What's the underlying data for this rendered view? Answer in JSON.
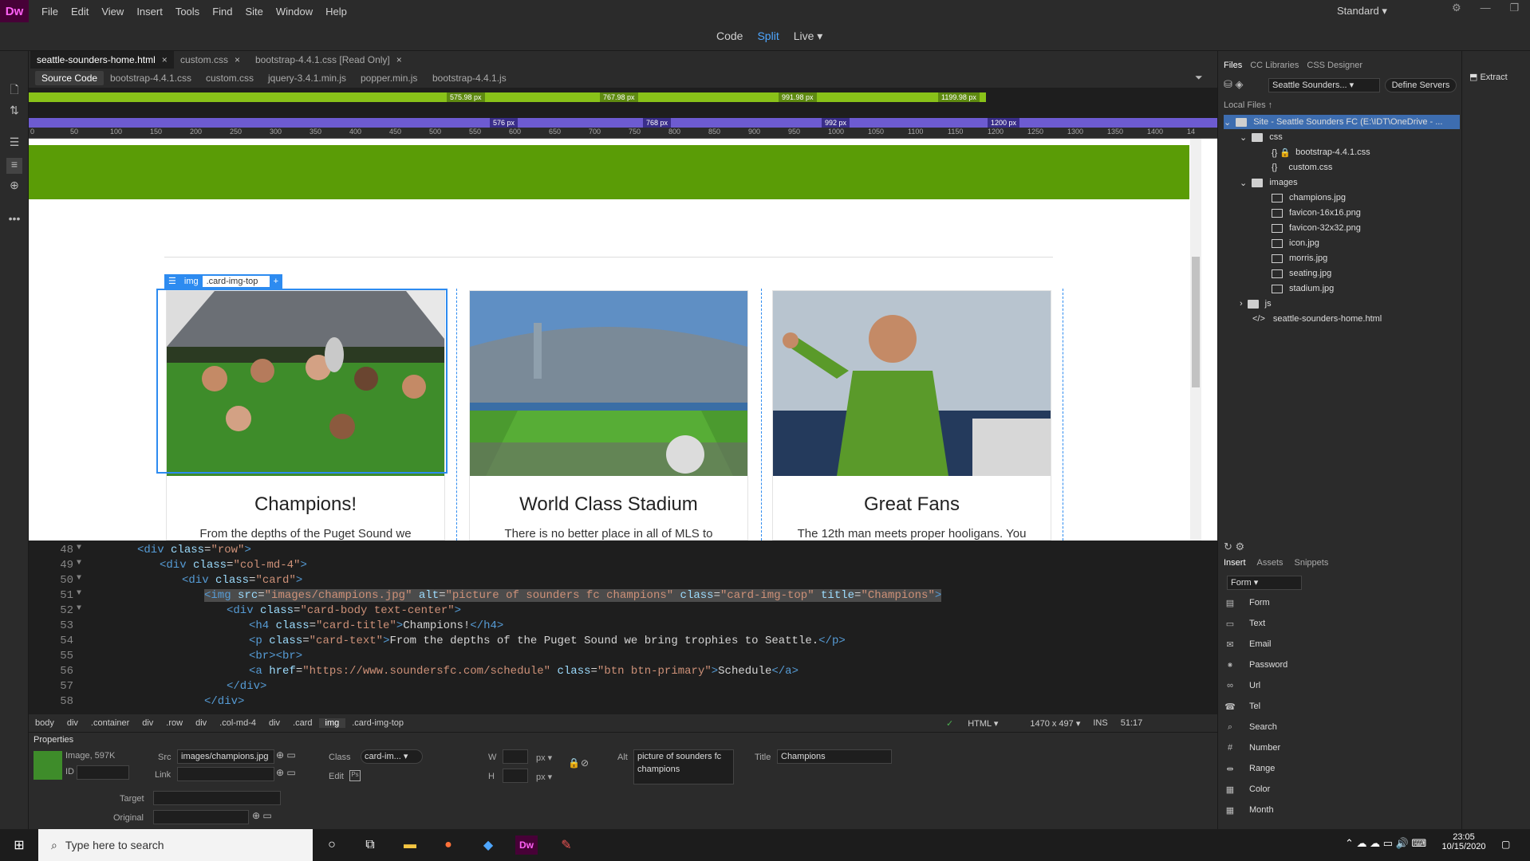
{
  "app": {
    "logo": "Dw",
    "menu": [
      "File",
      "Edit",
      "View",
      "Insert",
      "Tools",
      "Find",
      "Site",
      "Window",
      "Help"
    ],
    "workspace": "Standard"
  },
  "view": {
    "code": "Code",
    "split": "Split",
    "live": "Live"
  },
  "tabs": [
    {
      "label": "seattle-sounders-home.html"
    },
    {
      "label": "custom.css"
    },
    {
      "label": "bootstrap-4.4.1.css [Read Only]"
    }
  ],
  "source": [
    "Source Code",
    "bootstrap-4.4.1.css",
    "custom.css",
    "jquery-3.4.1.min.js",
    "popper.min.js",
    "bootstrap-4.4.1.js"
  ],
  "mq_max": [
    "575.98",
    "767.98",
    "991.98",
    "1199.98"
  ],
  "mq_min": [
    "576",
    "768",
    "992",
    "1200"
  ],
  "ruler": [
    "0",
    "50",
    "100",
    "150",
    "200",
    "250",
    "300",
    "350",
    "400",
    "450",
    "500",
    "550",
    "600",
    "650",
    "700",
    "750",
    "800",
    "850",
    "900",
    "950",
    "1000",
    "1050",
    "1100",
    "1150",
    "1200",
    "1250",
    "1300",
    "1350",
    "1400",
    "14"
  ],
  "eltag": {
    "tag": "img",
    "cls": ".card-img-top"
  },
  "cards": [
    {
      "title": "Champions!",
      "text": "From the depths of the Puget Sound we"
    },
    {
      "title": "World Class Stadium",
      "text": "There is no better place in all of MLS to"
    },
    {
      "title": "Great Fans",
      "text": "The 12th man meets proper hooligans. You"
    }
  ],
  "code": {
    "lines": [
      "48",
      "49",
      "50",
      "51",
      "52",
      "53",
      "54",
      "55",
      "56",
      "57",
      "58"
    ],
    "l48a": "<div ",
    "l48b": "class",
    "l48c": "=",
    "l48d": "\"row\"",
    "l48e": ">",
    "l49a": "<div ",
    "l49b": "class",
    "l49d": "\"col-md-4\"",
    "l49e": ">",
    "l50a": "<div ",
    "l50b": "class",
    "l50d": "\"card\"",
    "l50e": ">",
    "l51a": "<img ",
    "l51b": "src",
    "l51c": "=",
    "l51d": "\"images/champions.jpg\"",
    "l51f": " alt",
    "l51g": "\"picture of sounders fc champions\"",
    "l51h": " class",
    "l51i": "\"card-img-top\"",
    "l51j": " title",
    "l51k": "\"Champions\"",
    "l51e": ">",
    "l52a": "<div ",
    "l52b": "class",
    "l52d": "\"card-body text-center\"",
    "l52e": ">",
    "l53a": "<h4 ",
    "l53b": "class",
    "l53d": "\"card-title\"",
    "l53e": ">",
    "l53t": "Champions!",
    "l53z": "</h4>",
    "l54a": "<p ",
    "l54b": "class",
    "l54d": "\"card-text\"",
    "l54e": ">",
    "l54t": "From the depths of the Puget Sound we bring trophies to Seattle.",
    "l54z": "</p>",
    "l55": "<br><br>",
    "l56a": "<a ",
    "l56b": "href",
    "l56d": "\"https://www.soundersfc.com/schedule\"",
    "l56f": " class",
    "l56g": "\"btn btn-primary\"",
    "l56e": ">",
    "l56t": "Schedule",
    "l56z": "</a>",
    "l57": "</div>",
    "l58": "</div>"
  },
  "tagbar": [
    "body",
    "div",
    ".container",
    "div",
    ".row",
    "div",
    ".col-md-4",
    "div",
    ".card",
    "img",
    ".card-img-top"
  ],
  "status": {
    "lang": "HTML",
    "size": "1470 x 497",
    "mode": "INS",
    "pos": "51:17"
  },
  "props": {
    "header": "Properties",
    "type": "Image, 597K",
    "id_label": "ID",
    "src_label": "Src",
    "src": "images/champions.jpg",
    "link_label": "Link",
    "class_label": "Class",
    "class_val": "card-im...",
    "edit_label": "Edit",
    "w": "W",
    "h": "H",
    "px": "px",
    "alt_label": "Alt",
    "alt": "picture of sounders fc champions",
    "title_label": "Title",
    "title": "Champions",
    "target": "Target",
    "original": "Original"
  },
  "files": {
    "tabs": [
      "Files",
      "CC Libraries",
      "CSS Designer"
    ],
    "site": "Seattle Sounders...",
    "define": "Define Servers",
    "local": "Local Files",
    "tree": [
      "Site - Seattle Sounders FC (E:\\IDT\\OneDrive - ...",
      "css",
      "bootstrap-4.4.1.css",
      "custom.css",
      "images",
      "champions.jpg",
      "favicon-16x16.png",
      "favicon-32x32.png",
      "icon.jpg",
      "morris.jpg",
      "seating.jpg",
      "stadium.jpg",
      "js",
      "seattle-sounders-home.html"
    ]
  },
  "insert": {
    "tabs": [
      "Insert",
      "Assets",
      "Snippets"
    ],
    "category": "Form",
    "items": [
      "Form",
      "Text",
      "Email",
      "Password",
      "Url",
      "Tel",
      "Search",
      "Number",
      "Range",
      "Color",
      "Month"
    ]
  },
  "extract": "Extract",
  "taskbar": {
    "search": "Type here to search",
    "time": "23:05",
    "date": "10/15/2020"
  }
}
